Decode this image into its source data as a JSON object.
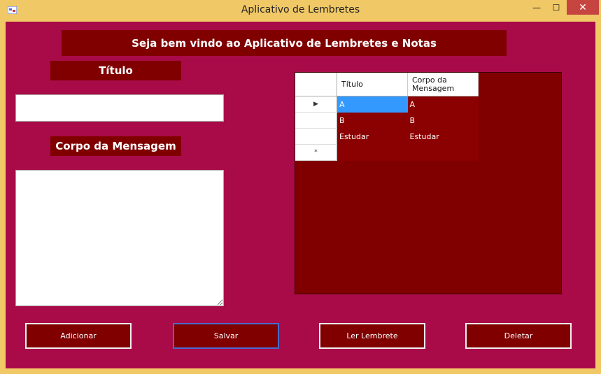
{
  "window": {
    "title": "Aplicativo de Lembretes",
    "min_glyph": "—",
    "max_glyph": "☐",
    "close_glyph": "✕"
  },
  "banner": "Seja bem vindo ao Aplicativo de Lembretes e Notas",
  "labels": {
    "titulo": "Título",
    "corpo": "Corpo da Mensagem"
  },
  "inputs": {
    "titulo_value": "",
    "corpo_value": ""
  },
  "grid": {
    "columns": [
      "Título",
      "Corpo da Mensagem"
    ],
    "rows": [
      {
        "marker": "▶",
        "titulo": "A",
        "corpo": "A"
      },
      {
        "marker": "",
        "titulo": "B",
        "corpo": "B"
      },
      {
        "marker": "",
        "titulo": "Estudar",
        "corpo": "Estudar"
      },
      {
        "marker": "*",
        "titulo": "",
        "corpo": ""
      }
    ]
  },
  "buttons": {
    "adicionar": "Adicionar",
    "salvar": "Salvar",
    "ler": "Ler Lembrete",
    "deletar": "Deletar"
  }
}
